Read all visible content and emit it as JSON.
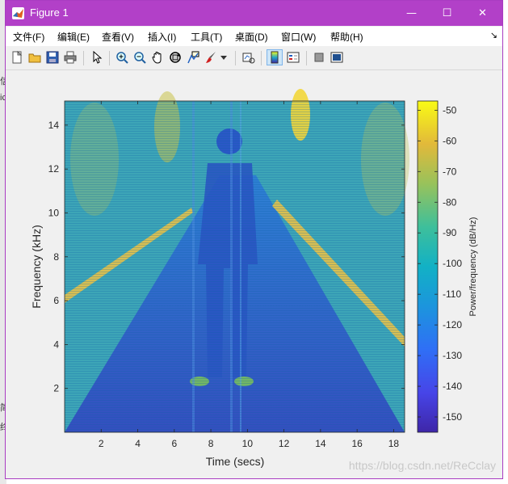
{
  "window": {
    "title": "Figure 1",
    "minimize_icon": "minimize-icon",
    "maximize_icon": "maximize-icon",
    "close_icon": "close-icon"
  },
  "background": {
    "left_fragments": [
      "信",
      "ic",
      "简",
      "终"
    ]
  },
  "menu": {
    "items": [
      {
        "label": "文件(F)"
      },
      {
        "label": "编辑(E)"
      },
      {
        "label": "查看(V)"
      },
      {
        "label": "插入(I)"
      },
      {
        "label": "工具(T)"
      },
      {
        "label": "桌面(D)"
      },
      {
        "label": "窗口(W)"
      },
      {
        "label": "帮助(H)"
      }
    ],
    "overflow_glyph": "↘"
  },
  "toolbar": {
    "icons": [
      "new-figure-icon",
      "open-file-icon",
      "save-icon",
      "print-icon",
      "pointer-icon",
      "zoom-in-icon",
      "zoom-out-icon",
      "pan-icon",
      "rotate-3d-icon",
      "data-cursor-icon",
      "brush-icon",
      "dropdown-arrow-icon",
      "link-plot-icon",
      "colorbar-icon",
      "legend-icon",
      "hide-plot-tools-icon",
      "show-plot-tools-icon"
    ]
  },
  "chart_data": {
    "type": "heatmap",
    "title": "",
    "xlabel": "Time (secs)",
    "ylabel": "Frequency (kHz)",
    "xlim": [
      0,
      18.6
    ],
    "ylim": [
      0,
      15.1
    ],
    "xticks": [
      "2",
      "4",
      "6",
      "8",
      "10",
      "12",
      "14",
      "16",
      "18"
    ],
    "xtick_values": [
      2,
      4,
      6,
      8,
      10,
      12,
      14,
      16,
      18
    ],
    "yticks": [
      "2",
      "4",
      "6",
      "8",
      "10",
      "12",
      "14"
    ],
    "ytick_values": [
      2,
      4,
      6,
      8,
      10,
      12,
      14
    ],
    "colorbar": {
      "label": "Power/frequency (dB/Hz)",
      "ticks": [
        "-50",
        "-60",
        "-70",
        "-80",
        "-90",
        "-100",
        "-110",
        "-120",
        "-130",
        "-140",
        "-150"
      ],
      "tick_values": [
        -50,
        -60,
        -70,
        -80,
        -90,
        -100,
        -110,
        -120,
        -130,
        -140,
        -150
      ],
      "range": [
        -155,
        -47
      ],
      "colormap": "parula"
    },
    "description_colors": {
      "low": "#3e26a8",
      "mid": "#1fa9c9",
      "high": "#f9fb15"
    },
    "grid": false
  },
  "watermark": "https://blog.csdn.net/ReCclay"
}
